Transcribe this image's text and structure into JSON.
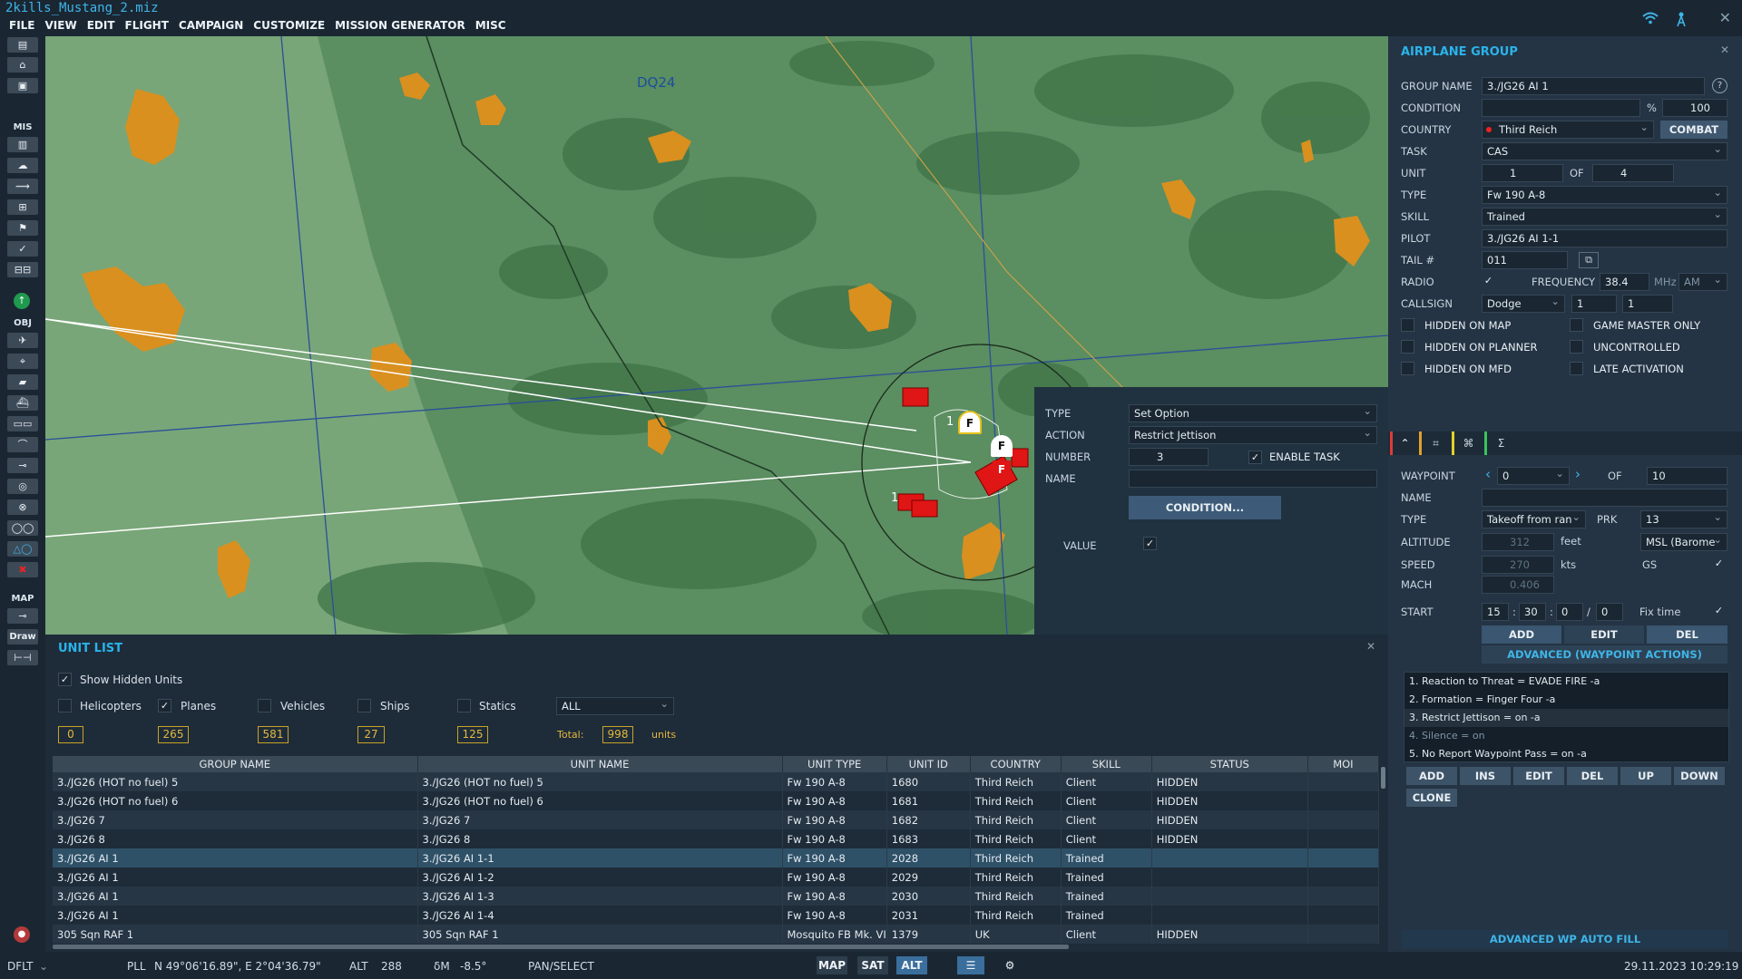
{
  "window": {
    "title": "2kills_Mustang_2.miz"
  },
  "menu": [
    "FILE",
    "VIEW",
    "EDIT",
    "FLIGHT",
    "CAMPAIGN",
    "CUSTOMIZE",
    "MISSION GENERATOR",
    "MISC"
  ],
  "top_icons": [
    "wifi-icon",
    "antenna-icon"
  ],
  "left_toolbar": {
    "sections": {
      "mis": "MIS",
      "obj": "OBJ",
      "map": "MAP"
    },
    "draw_label": "Draw"
  },
  "map": {
    "grid_label": "DQ24",
    "unit_numbers": [
      "1",
      "1"
    ],
    "markers": [
      "F",
      "F",
      "F"
    ]
  },
  "airplane_group": {
    "title": "AIRPLANE GROUP",
    "labels": {
      "group_name": "GROUP NAME",
      "condition": "CONDITION",
      "country": "COUNTRY",
      "task": "TASK",
      "unit": "UNIT",
      "of": "OF",
      "type": "TYPE",
      "skill": "SKILL",
      "pilot": "PILOT",
      "tail": "TAIL #",
      "radio": "RADIO",
      "frequency": "FREQUENCY",
      "mhz": "MHz",
      "callsign": "CALLSIGN",
      "percent": "%"
    },
    "group_name": "3./JG26 AI 1",
    "condition_value": "100",
    "country": "Third Reich",
    "combat_button": "COMBAT",
    "task": "CAS",
    "unit": "1",
    "unit_of": "4",
    "type": "Fw 190 A-8",
    "skill": "Trained",
    "pilot": "3./JG26 AI 1-1",
    "tail": "011",
    "frequency": "38.4",
    "modulation": "AM",
    "callsign": "Dodge",
    "callsign_num1": "1",
    "callsign_num2": "1",
    "flags": {
      "hidden_on_map": "HIDDEN ON MAP",
      "hidden_on_planner": "HIDDEN ON PLANNER",
      "hidden_on_mfd": "HIDDEN ON MFD",
      "game_master_only": "GAME MASTER ONLY",
      "uncontrolled": "UNCONTROLLED",
      "late_activation": "LATE ACTIVATION"
    }
  },
  "waypoint": {
    "labels": {
      "waypoint": "WAYPOINT",
      "of": "OF",
      "name": "NAME",
      "type": "TYPE",
      "prk": "PRK",
      "altitude": "ALTITUDE",
      "feet": "feet",
      "speed": "SPEED",
      "kts": "kts",
      "gs": "GS",
      "mach": "MACH",
      "start": "START",
      "fix_time": "Fix time"
    },
    "number": "0",
    "of": "10",
    "type": "Takeoff from ran",
    "prk": "13",
    "altitude": "312",
    "alt_type": "MSL (Barome",
    "speed": "270",
    "mach": "0.406",
    "start": [
      "15",
      "30",
      "0",
      "0"
    ],
    "buttons": {
      "add": "ADD",
      "edit": "EDIT",
      "del": "DEL"
    },
    "advanced_title": "ADVANCED (WAYPOINT ACTIONS)",
    "actions": [
      "1. Reaction to Threat = EVADE FIRE -a",
      "2. Formation = Finger Four -a",
      "3. Restrict Jettison = on -a",
      "4. Silence = on",
      "5. No Report Waypoint Pass = on -a"
    ],
    "action_buttons": [
      "ADD",
      "INS",
      "EDIT",
      "DEL",
      "UP",
      "DOWN"
    ],
    "clone": "CLONE",
    "auto_fill": "ADVANCED WP AUTO FILL"
  },
  "task_popup": {
    "labels": {
      "type": "TYPE",
      "action": "ACTION",
      "number": "NUMBER",
      "name": "NAME",
      "value": "VALUE",
      "enable_task": "ENABLE TASK"
    },
    "type": "Set Option",
    "action": "Restrict Jettison",
    "number": "3",
    "condition_button": "CONDITION..."
  },
  "unit_list": {
    "title": "UNIT LIST",
    "show_hidden": "Show Hidden Units",
    "filters": [
      {
        "label": "Helicopters",
        "checked": false,
        "count": "0"
      },
      {
        "label": "Planes",
        "checked": true,
        "count": "265"
      },
      {
        "label": "Vehicles",
        "checked": false,
        "count": "581"
      },
      {
        "label": "Ships",
        "checked": false,
        "count": "27"
      },
      {
        "label": "Statics",
        "checked": false,
        "count": "125"
      }
    ],
    "coalition": "ALL",
    "total_label": "Total:",
    "total": "998",
    "units_label": "units",
    "columns": [
      "GROUP NAME",
      "UNIT NAME",
      "UNIT TYPE",
      "UNIT ID",
      "COUNTRY",
      "SKILL",
      "STATUS",
      "MOI"
    ],
    "rows": [
      [
        "3./JG26 (HOT no fuel) 5",
        "3./JG26 (HOT no fuel) 5",
        "Fw 190 A-8",
        "1680",
        "Third Reich",
        "Client",
        "HIDDEN",
        ""
      ],
      [
        "3./JG26 (HOT no fuel) 6",
        "3./JG26 (HOT no fuel) 6",
        "Fw 190 A-8",
        "1681",
        "Third Reich",
        "Client",
        "HIDDEN",
        ""
      ],
      [
        "3./JG26 7",
        "3./JG26 7",
        "Fw 190 A-8",
        "1682",
        "Third Reich",
        "Client",
        "HIDDEN",
        ""
      ],
      [
        "3./JG26 8",
        "3./JG26 8",
        "Fw 190 A-8",
        "1683",
        "Third Reich",
        "Client",
        "HIDDEN",
        ""
      ],
      [
        "3./JG26 AI 1",
        "3./JG26 AI 1-1",
        "Fw 190 A-8",
        "2028",
        "Third Reich",
        "Trained",
        "",
        ""
      ],
      [
        "3./JG26 AI 1",
        "3./JG26 AI 1-2",
        "Fw 190 A-8",
        "2029",
        "Third Reich",
        "Trained",
        "",
        ""
      ],
      [
        "3./JG26 AI 1",
        "3./JG26 AI 1-3",
        "Fw 190 A-8",
        "2030",
        "Third Reich",
        "Trained",
        "",
        ""
      ],
      [
        "3./JG26 AI 1",
        "3./JG26 AI 1-4",
        "Fw 190 A-8",
        "2031",
        "Third Reich",
        "Trained",
        "",
        ""
      ],
      [
        "305 Sqn RAF 1",
        "305 Sqn RAF 1",
        "Mosquito FB Mk. VI",
        "1379",
        "UK",
        "Client",
        "HIDDEN",
        ""
      ]
    ],
    "selected_row": 4
  },
  "status_bar": {
    "mode": "DFLT",
    "coord_type": "PLL",
    "coords": "N 49°06'16.89\", E 2°04'36.79\"",
    "alt_label": "ALT",
    "alt": "288",
    "dm_label": "δM",
    "dm": "-8.5°",
    "pan": "PAN/SELECT",
    "map_btn": "MAP",
    "sat_btn": "SAT",
    "alt_btn": "ALT",
    "datetime": "29.11.2023 10:29:19"
  },
  "colors": {
    "accent": "#2bb3ea",
    "map_green": "#5b8e61",
    "town_orange": "#d9901f",
    "enemy_red": "#e01515",
    "count_gold": "#e4b93a"
  }
}
